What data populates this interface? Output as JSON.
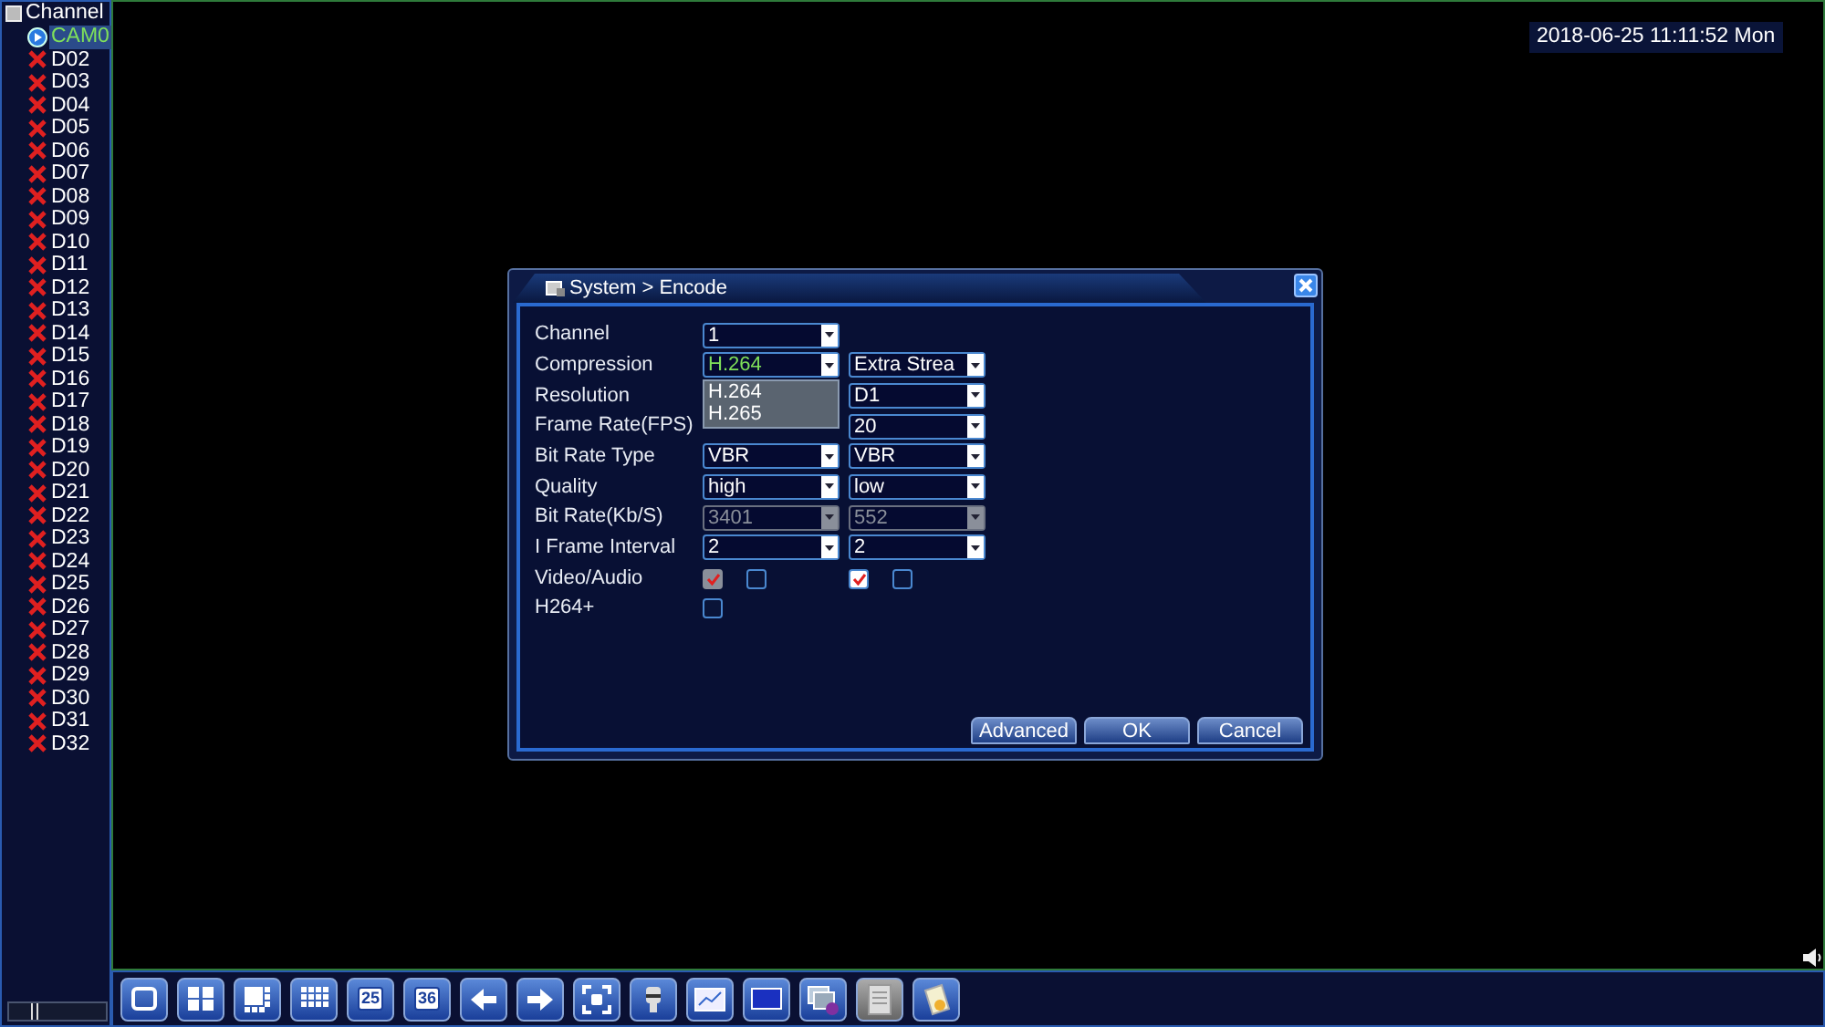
{
  "channel_tree": {
    "label": "Channel",
    "children": [
      {
        "label": "CAM0",
        "selected": true,
        "online": true
      },
      {
        "label": "D02",
        "selected": false,
        "online": false
      },
      {
        "label": "D03",
        "selected": false,
        "online": false
      },
      {
        "label": "D04",
        "selected": false,
        "online": false
      },
      {
        "label": "D05",
        "selected": false,
        "online": false
      },
      {
        "label": "D06",
        "selected": false,
        "online": false
      },
      {
        "label": "D07",
        "selected": false,
        "online": false
      },
      {
        "label": "D08",
        "selected": false,
        "online": false
      },
      {
        "label": "D09",
        "selected": false,
        "online": false
      },
      {
        "label": "D10",
        "selected": false,
        "online": false
      },
      {
        "label": "D11",
        "selected": false,
        "online": false
      },
      {
        "label": "D12",
        "selected": false,
        "online": false
      },
      {
        "label": "D13",
        "selected": false,
        "online": false
      },
      {
        "label": "D14",
        "selected": false,
        "online": false
      },
      {
        "label": "D15",
        "selected": false,
        "online": false
      },
      {
        "label": "D16",
        "selected": false,
        "online": false
      },
      {
        "label": "D17",
        "selected": false,
        "online": false
      },
      {
        "label": "D18",
        "selected": false,
        "online": false
      },
      {
        "label": "D19",
        "selected": false,
        "online": false
      },
      {
        "label": "D20",
        "selected": false,
        "online": false
      },
      {
        "label": "D21",
        "selected": false,
        "online": false
      },
      {
        "label": "D22",
        "selected": false,
        "online": false
      },
      {
        "label": "D23",
        "selected": false,
        "online": false
      },
      {
        "label": "D24",
        "selected": false,
        "online": false
      },
      {
        "label": "D25",
        "selected": false,
        "online": false
      },
      {
        "label": "D26",
        "selected": false,
        "online": false
      },
      {
        "label": "D27",
        "selected": false,
        "online": false
      },
      {
        "label": "D28",
        "selected": false,
        "online": false
      },
      {
        "label": "D29",
        "selected": false,
        "online": false
      },
      {
        "label": "D30",
        "selected": false,
        "online": false
      },
      {
        "label": "D31",
        "selected": false,
        "online": false
      },
      {
        "label": "D32",
        "selected": false,
        "online": false
      }
    ]
  },
  "datetime": "2018-06-25 11:11:52 Mon",
  "dialog": {
    "title": "System > Encode",
    "rows": [
      {
        "label": "Channel",
        "fields": [
          {
            "kind": "select",
            "value": "1",
            "disabled": false,
            "focused": false
          }
        ]
      },
      {
        "label": "Compression",
        "fields": [
          {
            "kind": "select",
            "value": "H.264",
            "disabled": false,
            "focused": true,
            "expanded": true,
            "options": [
              "H.264",
              "H.265"
            ]
          },
          {
            "kind": "select",
            "value": "Extra Strea",
            "disabled": false,
            "focused": false
          }
        ]
      },
      {
        "label": "Resolution",
        "fields": [
          {
            "kind": "blank"
          },
          {
            "kind": "select",
            "value": "D1",
            "disabled": false,
            "focused": false
          }
        ]
      },
      {
        "label": "Frame Rate(FPS)",
        "fields": [
          {
            "kind": "blank"
          },
          {
            "kind": "select",
            "value": "20",
            "disabled": false,
            "focused": false
          }
        ]
      },
      {
        "label": "Bit Rate Type",
        "fields": [
          {
            "kind": "select",
            "value": "VBR",
            "disabled": false,
            "focused": false
          },
          {
            "kind": "select",
            "value": "VBR",
            "disabled": false,
            "focused": false
          }
        ]
      },
      {
        "label": "Quality",
        "fields": [
          {
            "kind": "select",
            "value": "high",
            "disabled": false,
            "focused": false
          },
          {
            "kind": "select",
            "value": "low",
            "disabled": false,
            "focused": false
          }
        ]
      },
      {
        "label": "Bit Rate(Kb/S)",
        "fields": [
          {
            "kind": "select",
            "value": "3401",
            "disabled": true,
            "focused": false
          },
          {
            "kind": "select",
            "value": "552",
            "disabled": true,
            "focused": false
          }
        ]
      },
      {
        "label": "I Frame Interval",
        "fields": [
          {
            "kind": "select",
            "value": "2",
            "disabled": false,
            "focused": false
          },
          {
            "kind": "select",
            "value": "2",
            "disabled": false,
            "focused": false
          }
        ]
      },
      {
        "label": "Video/Audio",
        "fields": [
          {
            "kind": "checks",
            "checks": [
              {
                "checked": true,
                "disabled": true
              },
              {
                "checked": false,
                "disabled": false
              }
            ]
          },
          {
            "kind": "checks",
            "checks": [
              {
                "checked": true,
                "disabled": false
              },
              {
                "checked": false,
                "disabled": false
              }
            ]
          }
        ]
      },
      {
        "label": "H264+",
        "fields": [
          {
            "kind": "checks",
            "checks": [
              {
                "checked": false,
                "disabled": false
              }
            ]
          }
        ]
      }
    ],
    "buttons": [
      "Advanced",
      "OK",
      "Cancel"
    ]
  },
  "toolbar": [
    {
      "kind": "single"
    },
    {
      "kind": "quad"
    },
    {
      "kind": "eight"
    },
    {
      "kind": "nine"
    },
    {
      "kind": "number",
      "label": "25"
    },
    {
      "kind": "number",
      "label": "36"
    },
    {
      "kind": "previous"
    },
    {
      "kind": "next"
    },
    {
      "kind": "fullscreen"
    },
    {
      "kind": "camera"
    },
    {
      "kind": "chart"
    },
    {
      "kind": "screen"
    },
    {
      "kind": "windows"
    },
    {
      "kind": "document"
    },
    {
      "kind": "notes"
    }
  ]
}
